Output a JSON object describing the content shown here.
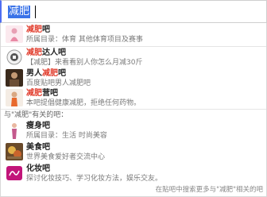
{
  "search": {
    "query": "减肥"
  },
  "suggestions": [
    {
      "title_hl": "减肥",
      "title_rest": "吧",
      "desc": "所属目录：体育  其他体育项目及赛事",
      "icon": "pink-figure-thumb"
    },
    {
      "title_hl": "减肥",
      "title_rest": "达人吧",
      "desc": "【减肥】来看看别人你怎么月减30斤",
      "icon": "round-badge-thumb"
    },
    {
      "title_pre": "男人",
      "title_hl": "减肥",
      "title_rest": "吧",
      "desc": "百度贴吧男人减肥吧",
      "icon": "man-photo-thumb"
    },
    {
      "title_hl": "减肥",
      "title_rest": "营吧",
      "desc": "本吧提倡健康减肥，拒绝任何药物。",
      "icon": "woman-photo-thumb"
    }
  ],
  "related_label": "与\"减肥\"有关的吧：",
  "related": [
    {
      "title": "瘦身吧",
      "desc": "所属目录：生活  时尚美容",
      "icon": "woman-figure-thumb"
    },
    {
      "title": "美食吧",
      "desc": "世界美食爱好者交流中心",
      "icon": "food-photo-thumb"
    },
    {
      "title": "化妆吧",
      "desc": "探讨化妆技巧、学习化妆方法，娱乐交友。",
      "icon": "makeup-logo-thumb"
    }
  ],
  "footer": "在贴吧中搜索更多与\"减肥\"相关的吧",
  "colors": {
    "highlight": "#e13b2b",
    "selection": "#3a73e8",
    "accent_border": "#4e6ef2"
  }
}
